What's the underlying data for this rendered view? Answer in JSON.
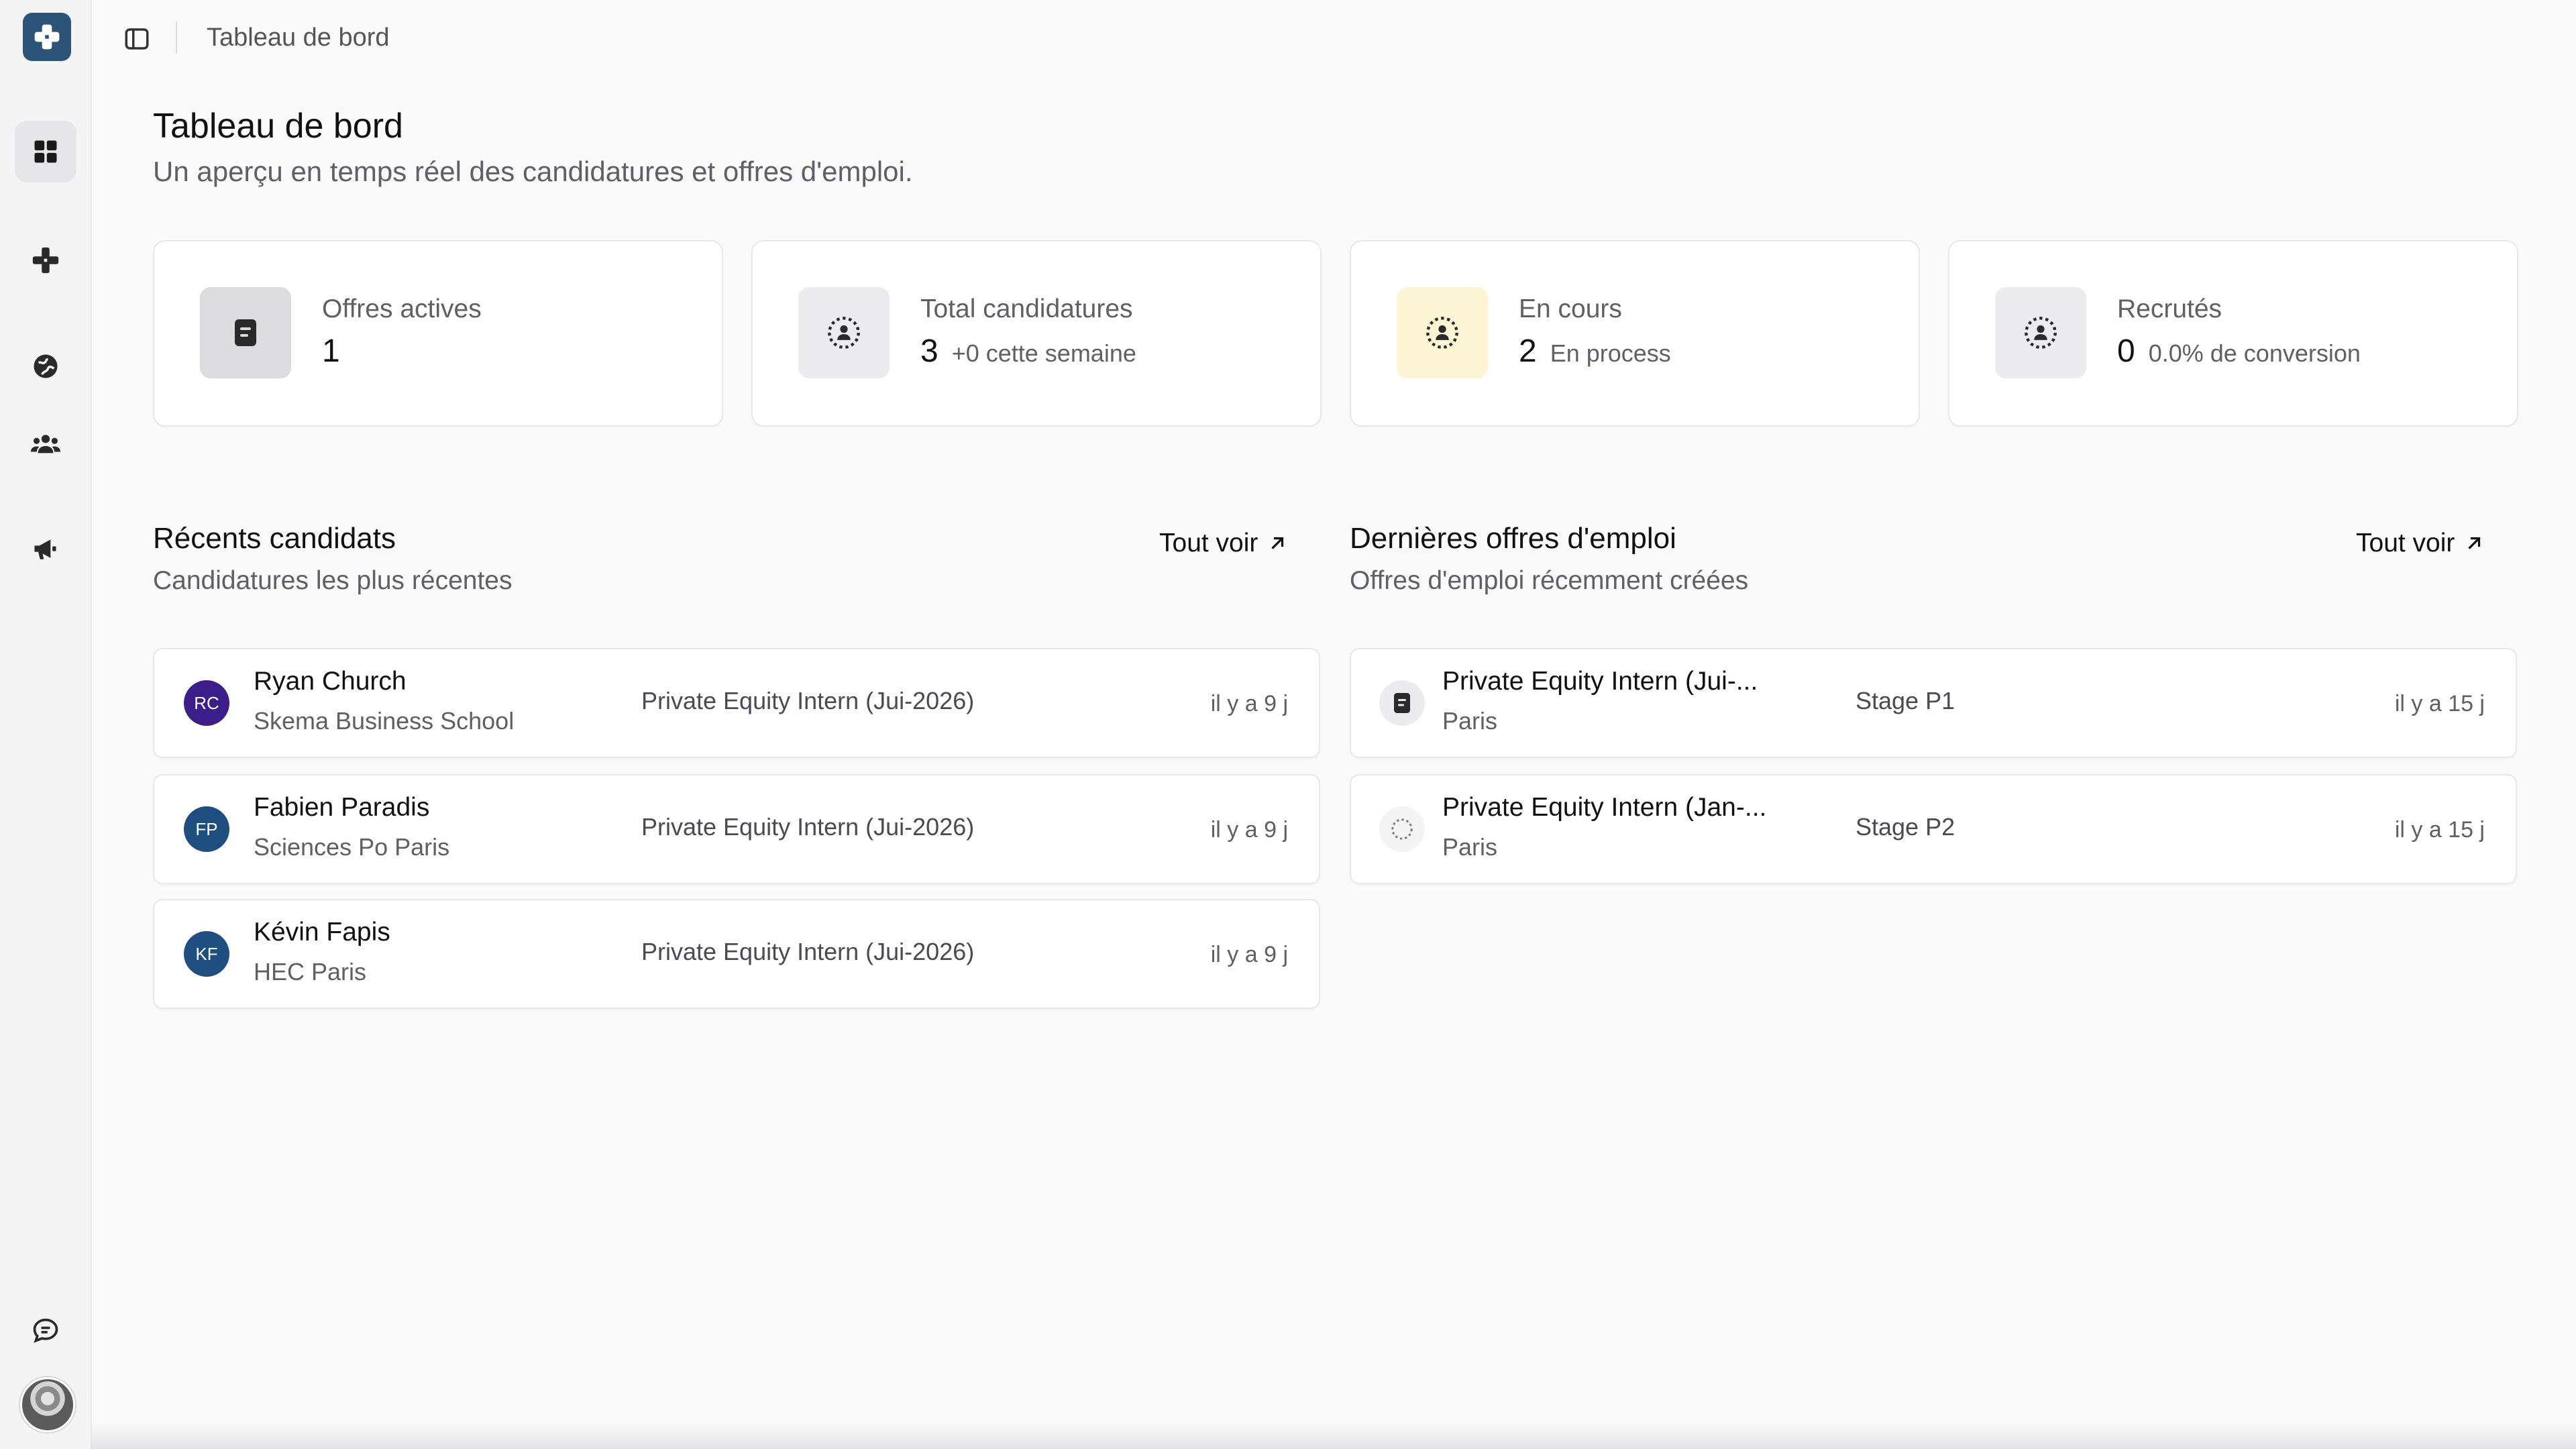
{
  "colors": {
    "brand": "#2b5478",
    "avatar_purple": "#3b1e8a",
    "avatar_blue": "#1e4f80",
    "in_progress_bg": "#fdf5d3"
  },
  "sidebar": {
    "logo_icon": "puzzle-icon",
    "items": [
      {
        "icon": "dashboard-grid-icon",
        "active": true
      },
      {
        "icon": "puzzle-icon",
        "active": false
      },
      {
        "icon": "globe-icon",
        "active": false
      },
      {
        "icon": "users-icon",
        "active": false
      },
      {
        "icon": "megaphone-icon",
        "active": false
      }
    ],
    "bottom": [
      {
        "icon": "chat-icon"
      },
      {
        "icon": "user-avatar"
      }
    ]
  },
  "topbar": {
    "breadcrumb": "Tableau de bord"
  },
  "page": {
    "title": "Tableau de bord",
    "subtitle": "Un aperçu en temps réel des candidatures et offres d'emploi."
  },
  "stats": [
    {
      "label": "Offres actives",
      "value": "1",
      "note": "",
      "icon": "document-icon"
    },
    {
      "label": "Total candidatures",
      "value": "3",
      "note": "+0 cette semaine",
      "icon": "people-circle-icon"
    },
    {
      "label": "En cours",
      "value": "2",
      "note": "En process",
      "icon": "people-circle-icon"
    },
    {
      "label": "Recrutés",
      "value": "0",
      "note": "0.0% de conversion",
      "icon": "people-circle-icon"
    }
  ],
  "recent_candidates": {
    "title": "Récents candidats",
    "subtitle": "Candidatures les plus récentes",
    "see_all": "Tout voir",
    "items": [
      {
        "initials": "RC",
        "name": "Ryan Church",
        "school": "Skema Business School",
        "job": "Private Equity Intern (Jui-2026)",
        "time": "il y a 9 j"
      },
      {
        "initials": "FP",
        "name": "Fabien Paradis",
        "school": "Sciences Po Paris",
        "job": "Private Equity Intern (Jui-2026)",
        "time": "il y a 9 j"
      },
      {
        "initials": "KF",
        "name": "Kévin Fapis",
        "school": "HEC Paris",
        "job": "Private Equity Intern (Jui-2026)",
        "time": "il y a 9 j"
      }
    ]
  },
  "latest_jobs": {
    "title": "Dernières offres d'emploi",
    "subtitle": "Offres d'emploi récemment créées",
    "see_all": "Tout voir",
    "items": [
      {
        "title": "Private Equity Intern (Jui-...",
        "location": "Paris",
        "stage": "Stage P1",
        "time": "il y a 15 j",
        "icon": "document-icon"
      },
      {
        "title": "Private Equity Intern (Jan-...",
        "location": "Paris",
        "stage": "Stage P2",
        "time": "il y a 15 j",
        "icon": "dashed-circle-icon"
      }
    ]
  }
}
